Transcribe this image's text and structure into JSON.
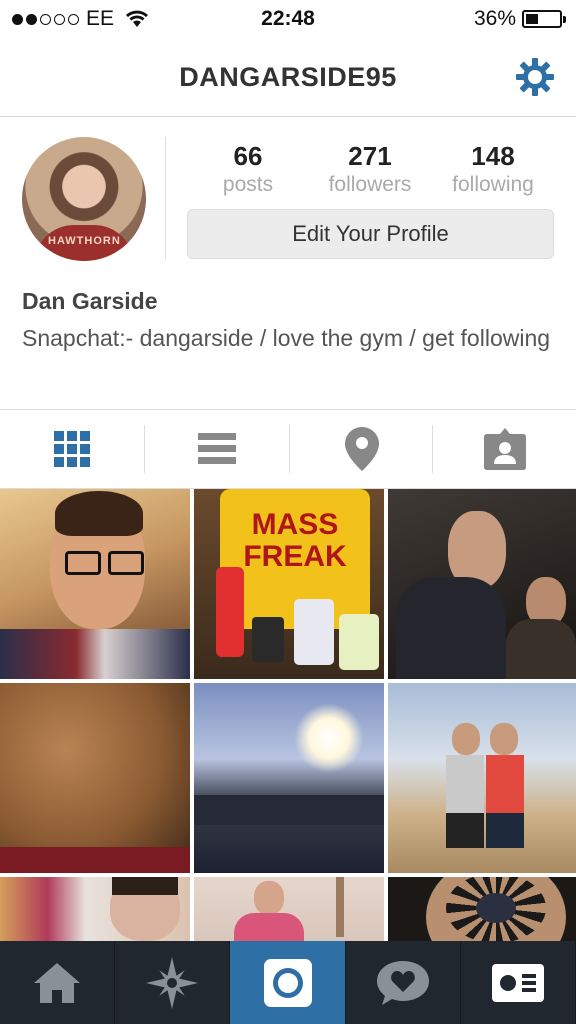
{
  "status_bar": {
    "carrier": "EE",
    "time": "22:48",
    "battery": "36%"
  },
  "header": {
    "username": "DANGARSIDE95"
  },
  "profile": {
    "avatar_text": "HAWTHORN",
    "stats": [
      {
        "value": "66",
        "label": "posts"
      },
      {
        "value": "271",
        "label": "followers"
      },
      {
        "value": "148",
        "label": "following"
      }
    ],
    "edit_label": "Edit Your Profile",
    "name": "Dan Garside",
    "bio": "Snapchat:- dangarside / love the gym / get following"
  },
  "view_toggles": [
    "grid-icon",
    "list-icon",
    "location-pin-icon",
    "tagged-person-icon"
  ],
  "photos": [
    {
      "name": "photo-selfie-glasses",
      "colors": [
        "#d9b070",
        "#8f6140"
      ]
    },
    {
      "name": "photo-mass-freak-supplements",
      "label": "MASS FREAK",
      "colors": [
        "#f2c21a",
        "#5a4128"
      ]
    },
    {
      "name": "photo-night-out",
      "colors": [
        "#3a3530",
        "#121010"
      ]
    },
    {
      "name": "photo-close-up-skin",
      "colors": [
        "#a8743f",
        "#5c3d22"
      ]
    },
    {
      "name": "photo-sunset-pool",
      "colors": [
        "#8ba0c9",
        "#2a2f3c"
      ]
    },
    {
      "name": "photo-two-friends-balcony",
      "colors": [
        "#9fb6cf",
        "#c8a77a"
      ]
    },
    {
      "name": "photo-selfie-face",
      "colors": [
        "#e0c4b0",
        "#a0766a"
      ]
    },
    {
      "name": "photo-mirror-selfie",
      "colors": [
        "#d9b3a0",
        "#7d5a50"
      ]
    },
    {
      "name": "photo-tattoo-shoulder",
      "colors": [
        "#b08a70",
        "#1e1a18"
      ]
    }
  ],
  "tabbar": [
    "home-icon",
    "explore-star-icon",
    "camera-icon",
    "activity-heart-icon",
    "profile-card-icon"
  ]
}
